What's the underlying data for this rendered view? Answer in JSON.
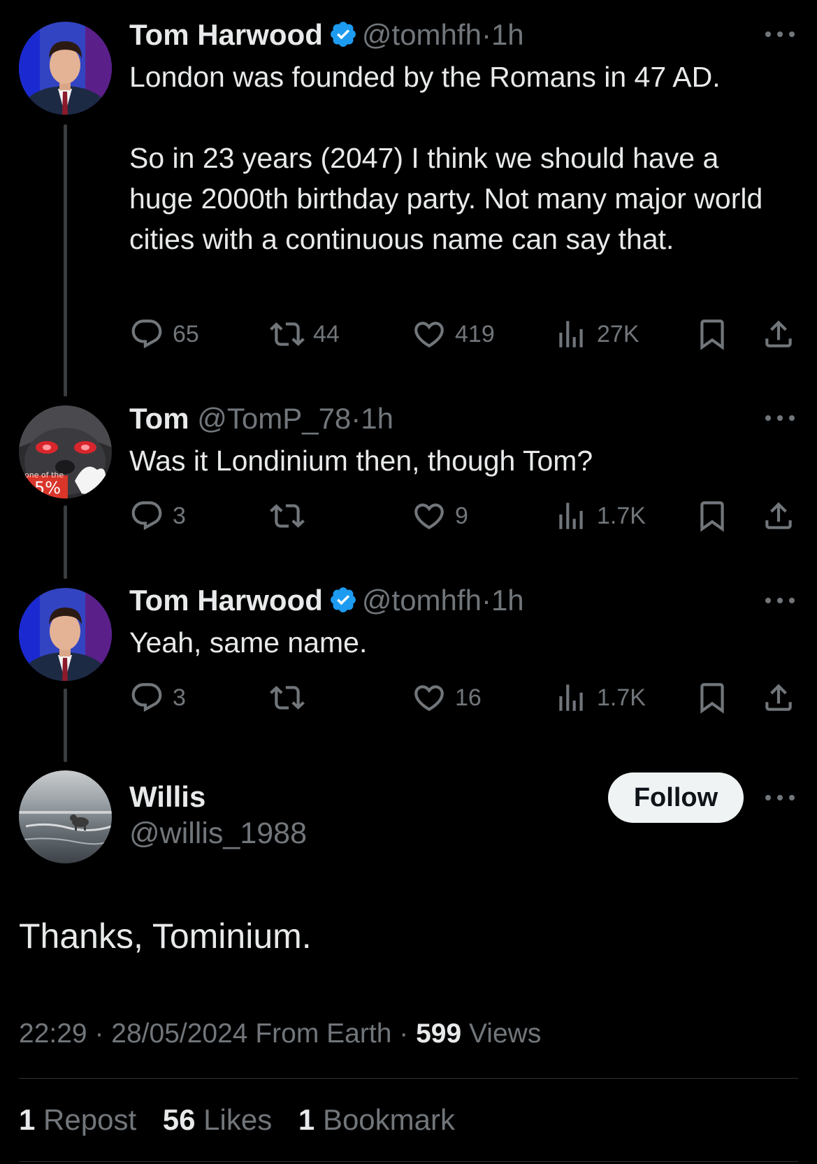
{
  "thread": [
    {
      "name": "Tom Harwood",
      "verified": true,
      "handle": "@tomhfh",
      "time": "1h",
      "text": "London was founded by the Romans in 47 AD.\n\nSo in 23 years (2047) I think we should have a huge 2000th birthday party. Not many major world cities with a continuous name can say that.",
      "replies": "65",
      "reposts": "44",
      "likes": "419",
      "views": "27K"
    },
    {
      "name": "Tom",
      "verified": false,
      "handle": "@TomP_78",
      "time": "1h",
      "text": "Was it Londinium then, though Tom?",
      "avatar_badge": "5%",
      "avatar_badge_small": "one of the",
      "replies": "3",
      "reposts": "",
      "likes": "9",
      "views": "1.7K"
    },
    {
      "name": "Tom Harwood",
      "verified": true,
      "handle": "@tomhfh",
      "time": "1h",
      "text": "Yeah, same name.",
      "replies": "3",
      "reposts": "",
      "likes": "16",
      "views": "1.7K"
    }
  ],
  "main": {
    "name": "Willis",
    "handle": "@willis_1988",
    "follow_label": "Follow",
    "text": "Thanks, Tominium.",
    "time": "22:29",
    "date": "28/05/2024",
    "source": "From Earth",
    "views_count": "599",
    "views_label": "Views",
    "reposts_count": "1",
    "reposts_label": "Repost",
    "likes_count": "56",
    "likes_label": "Likes",
    "bookmarks_count": "1",
    "bookmarks_label": "Bookmark"
  },
  "separator": "·",
  "colors": {
    "background": "#000000",
    "text_primary": "#e7e9ea",
    "text_secondary": "#71767b",
    "verified_blue": "#1d9bf0",
    "follow_bg": "#eff3f4",
    "divider": "#2f3336"
  },
  "icons": [
    "verified-badge-icon",
    "more-icon",
    "reply-icon",
    "repost-icon",
    "like-icon",
    "views-icon",
    "bookmark-icon",
    "share-icon"
  ]
}
